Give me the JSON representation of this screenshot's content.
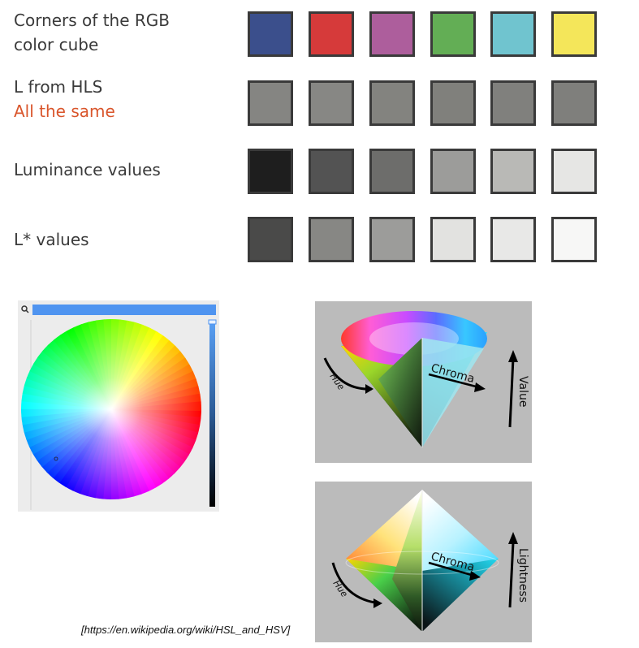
{
  "rows": [
    {
      "label_lines": [
        "Corners of the RGB",
        "color cube"
      ],
      "accent": "",
      "swatches": [
        "#3b4f8c",
        "#d63a3a",
        "#ad5e9c",
        "#63ae55",
        "#70c4cf",
        "#f4e65a"
      ]
    },
    {
      "label_lines": [
        "L from HLS"
      ],
      "accent": "All the same",
      "swatches": [
        "#858582",
        "#878784",
        "#83837f",
        "#80807c",
        "#80807d",
        "#7f7f7c"
      ]
    },
    {
      "label_lines": [
        "Luminance values"
      ],
      "accent": "",
      "swatches": [
        "#1e1e1e",
        "#535353",
        "#6d6d6b",
        "#9c9c9a",
        "#b9b9b6",
        "#e6e6e4"
      ]
    },
    {
      "label_lines": [
        "L* values"
      ],
      "accent": "",
      "swatches": [
        "#4a4a49",
        "#878784",
        "#9c9c9a",
        "#e2e2e0",
        "#e8e8e7",
        "#f7f7f6"
      ]
    }
  ],
  "colors": {
    "accent": "#d9552b",
    "border": "#3a3a3a",
    "picker_blue": "#4f94f0"
  },
  "picker": {
    "search_icon": "search-icon",
    "search_value": ""
  },
  "hsv_cone": {
    "hue_label": "Hue",
    "chroma_label": "Chroma",
    "value_label": "Value"
  },
  "hsl_bicone": {
    "hue_label": "Hue",
    "chroma_label": "Chroma",
    "lightness_label": "Lightness"
  },
  "source": "[https://en.wikipedia.org/wiki/HSL_and_HSV]"
}
